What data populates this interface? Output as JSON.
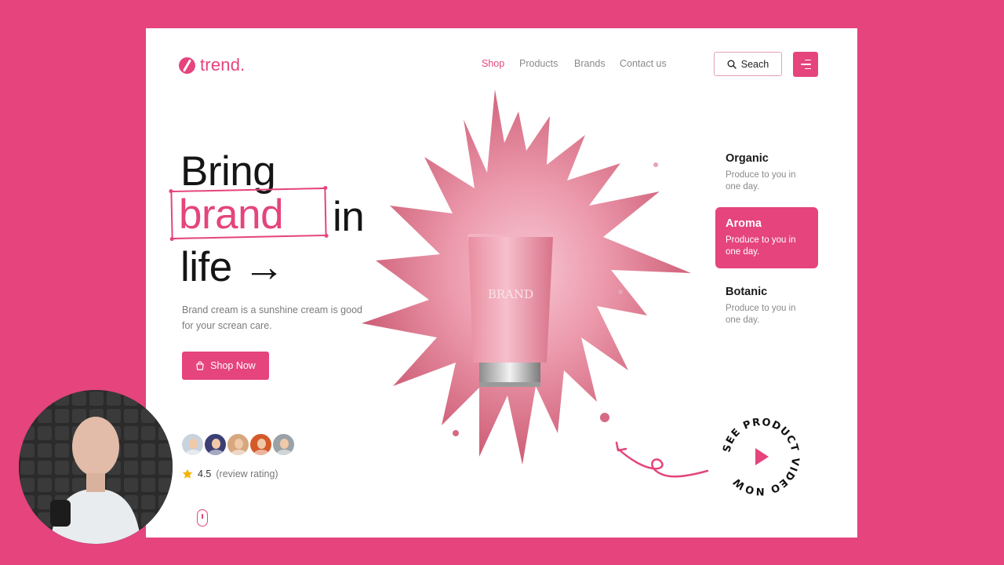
{
  "brand": {
    "name": "trend."
  },
  "nav": [
    {
      "label": "Shop",
      "active": true
    },
    {
      "label": "Products",
      "active": false
    },
    {
      "label": "Brands",
      "active": false
    },
    {
      "label": "Contact us",
      "active": false
    }
  ],
  "search": {
    "label": "Seach",
    "icon": "search-icon"
  },
  "menu": {
    "icon": "menu-icon"
  },
  "hero": {
    "line1": "Bring",
    "line2_highlight": "brand",
    "line2_rest": "in",
    "line3": "life →",
    "description": "Brand cream is a sunshine cream is good for your screan care.",
    "cta_label": "Shop Now",
    "cta_icon": "shopping-bag-icon"
  },
  "product": {
    "tube_text": "BRAND"
  },
  "reviews": {
    "score": "4.5",
    "label": "(review rating)",
    "icon": "star-icon",
    "avatar_count": 5
  },
  "features": [
    {
      "title": "Organic",
      "desc": "Produce to you in one day.",
      "active": false
    },
    {
      "title": "Aroma",
      "desc": "Produce to you in one day.",
      "active": true
    },
    {
      "title": "Botanic",
      "desc": "Produce to you in one day.",
      "active": false
    }
  ],
  "video_badge": {
    "text": "SEE PRODUCT VIDEO NOW",
    "icon": "play-icon"
  },
  "colors": {
    "accent": "#e5447d",
    "background": "#ffffff",
    "text": "#151515",
    "muted": "#7b7b7b"
  }
}
